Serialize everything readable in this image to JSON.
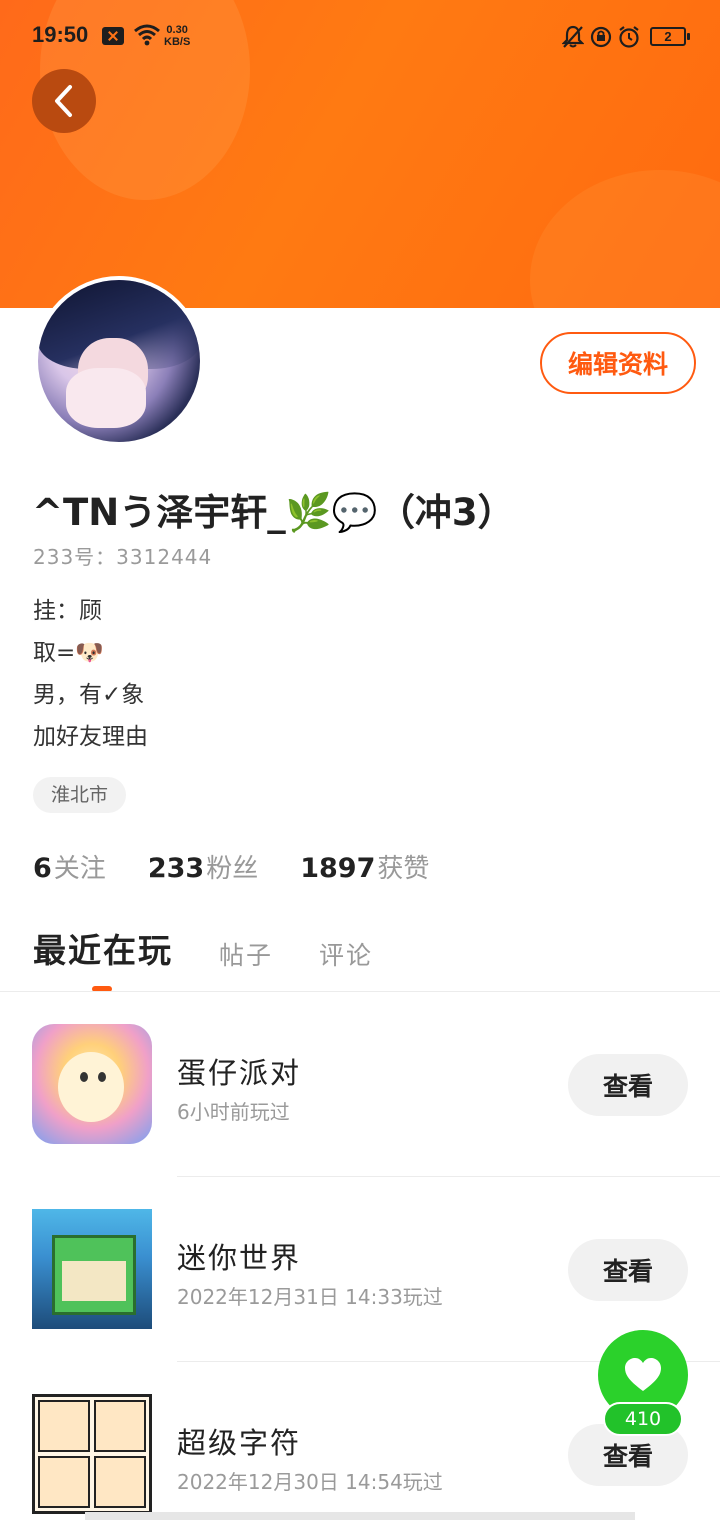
{
  "status_bar": {
    "time": "19:50",
    "speed_value": "0.30",
    "speed_unit": "KB/S",
    "battery": "2",
    "icons": [
      "close-box-icon",
      "wifi-icon",
      "mute-bell-icon",
      "rotation-lock-icon",
      "alarm-icon",
      "battery-icon"
    ]
  },
  "profile": {
    "name": "^TNう泽宇轩_🌿💬（冲3）",
    "uid": "233号：3312444",
    "edit_label": "编辑资料",
    "bio": [
      "挂：顾",
      "取=🐶",
      "男，有✓象",
      "加好友理由"
    ],
    "location": "淮北市"
  },
  "stats": [
    {
      "num": "6",
      "label": "关注"
    },
    {
      "num": "233",
      "label": "粉丝"
    },
    {
      "num": "1897",
      "label": "获赞"
    }
  ],
  "tabs": [
    "最近在玩",
    "帖子",
    "评论"
  ],
  "games": [
    {
      "name": "蛋仔派对",
      "time": "6小时前玩过",
      "action": "查看"
    },
    {
      "name": "迷你世界",
      "time": "2022年12月31日 14:33玩过",
      "action": "查看"
    },
    {
      "name": "超级字符",
      "time": "2022年12月30日 14:54玩过",
      "action": "查看"
    }
  ],
  "like": {
    "count": "410"
  },
  "colors": {
    "accent": "#ff5a10",
    "banner": "#ff7417",
    "like_green": "#2bd12b"
  }
}
